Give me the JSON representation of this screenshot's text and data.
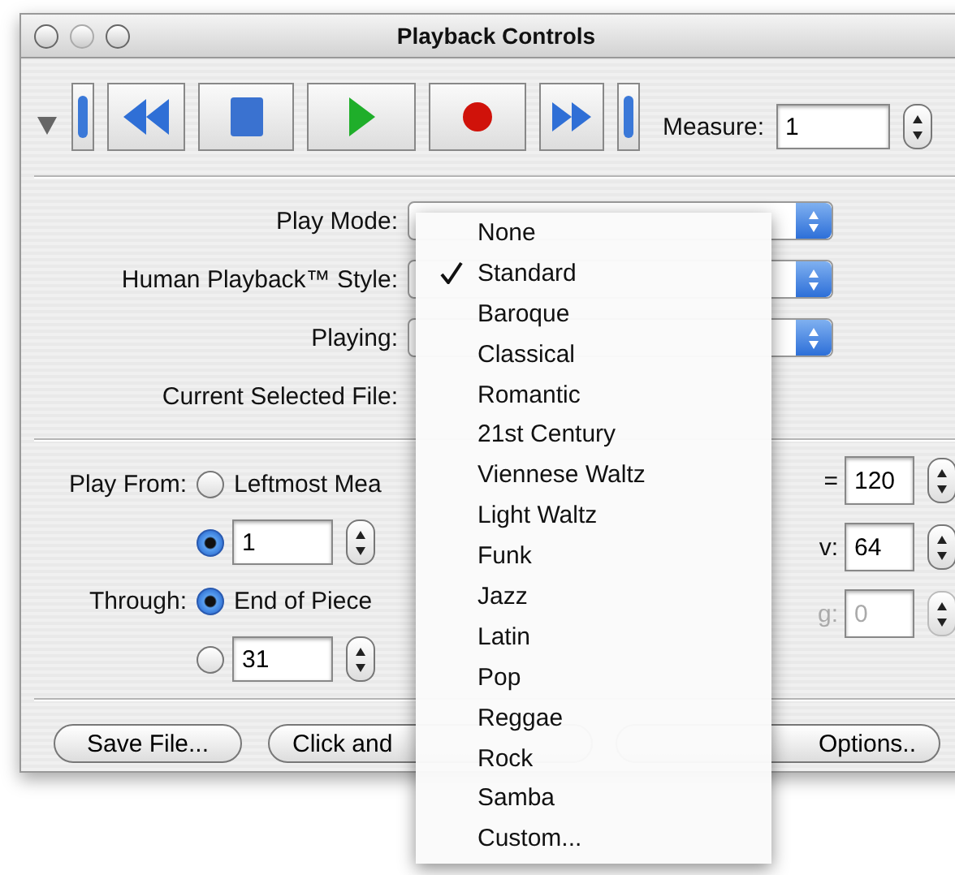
{
  "window": {
    "title": "Playback Controls"
  },
  "measure": {
    "label": "Measure:",
    "value": "1"
  },
  "form": [
    {
      "label": "Play Mode:"
    },
    {
      "label": "Human Playback™ Style:"
    },
    {
      "label": "Playing:"
    },
    {
      "label": "Current Selected File:"
    }
  ],
  "play_from": {
    "label": "Play From:",
    "options": [
      {
        "label": "Leftmost Mea",
        "selected": false
      },
      {
        "value": "1",
        "selected": true
      }
    ]
  },
  "through": {
    "label": "Through:",
    "options": [
      {
        "label": "End of Piece",
        "selected": true
      },
      {
        "value": "31",
        "selected": false
      }
    ]
  },
  "right_fields": [
    {
      "label": "=",
      "value": "120",
      "disabled": false
    },
    {
      "label": "v:",
      "value": "64",
      "disabled": false
    },
    {
      "label": "g:",
      "value": "0",
      "disabled": true
    }
  ],
  "buttons": [
    "Save File...",
    "Click and",
    "Options.."
  ],
  "menu": {
    "items": [
      {
        "label": "None",
        "checked": false
      },
      {
        "label": "Standard",
        "checked": true
      },
      {
        "label": "Baroque",
        "checked": false
      },
      {
        "label": "Classical",
        "checked": false
      },
      {
        "label": "Romantic",
        "checked": false
      },
      {
        "label": "21st Century",
        "checked": false
      },
      {
        "label": "Viennese Waltz",
        "checked": false
      },
      {
        "label": "Light Waltz",
        "checked": false
      },
      {
        "label": "Funk",
        "checked": false
      },
      {
        "label": "Jazz",
        "checked": false
      },
      {
        "label": "Latin",
        "checked": false
      },
      {
        "label": "Pop",
        "checked": false
      },
      {
        "label": "Reggae",
        "checked": false
      },
      {
        "label": "Rock",
        "checked": false
      },
      {
        "label": "Samba",
        "checked": false
      },
      {
        "label": "Custom...",
        "checked": false
      }
    ]
  }
}
